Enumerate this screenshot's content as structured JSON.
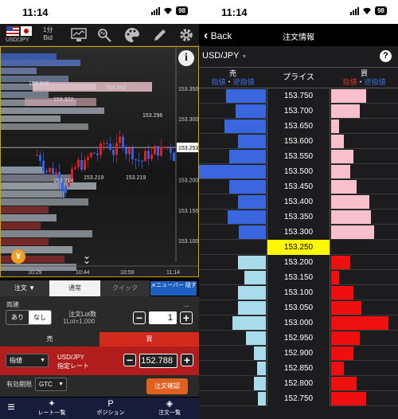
{
  "status": {
    "time": "11:14",
    "battery": "98"
  },
  "chart_screen": {
    "pair": "USD/JPY",
    "timeframe_num": "1分",
    "timeframe_label": "Bid",
    "price_labels": [
      "153.350",
      "153.300",
      "153.253",
      "153.200",
      "153.150",
      "153.100"
    ],
    "time_labels": [
      "10:29",
      "10:44",
      "10:59",
      "11:14"
    ],
    "annotations": [
      "153.349",
      "153.342",
      "153.322",
      "153.296",
      "153.214",
      "153.219",
      "153.219"
    ],
    "current_price": "153.253",
    "info_icon": "i",
    "yen_icon": "¥"
  },
  "order_panel": {
    "tabs": [
      "注文 ▼",
      "通常",
      "クイック",
      "メニューバー 隠す"
    ],
    "both_label": "両建",
    "both_options": [
      "あり",
      "なし"
    ],
    "lot_label": "注文Lot数",
    "lot_sub": "1Lot=1,000",
    "lot_value": "1",
    "more_icon": "...",
    "sell": "売",
    "buy": "買",
    "order_type": "指値",
    "rate_label_1": "USD/JPY",
    "rate_label_2": "指定レート",
    "rate_value": "152.788",
    "expiry_label": "有効期限",
    "expiry_value": "GTC",
    "confirm": "注文確認",
    "minus": "−",
    "plus": "+"
  },
  "bottom_nav": [
    {
      "icon": "✦",
      "label": "レート一覧"
    },
    {
      "icon": "P",
      "label": "ポジション"
    },
    {
      "icon": "◈",
      "label": "注文一覧"
    }
  ],
  "menu_icon": "≡",
  "right": {
    "back": "Back",
    "title": "注文情報",
    "pair": "USD/JPY",
    "pair_caret": "▼",
    "help": "?",
    "headers": {
      "sell": "売",
      "price": "プライス",
      "buy": "買"
    },
    "sell_sub": [
      "指値",
      "・",
      "逆指値"
    ],
    "buy_sub": [
      "指値",
      "・",
      "逆指値"
    ],
    "rows": [
      {
        "price": "153.750",
        "sell": 0.6,
        "buy": 0.55
      },
      {
        "price": "153.700",
        "sell": 0.45,
        "buy": 0.45
      },
      {
        "price": "153.650",
        "sell": 0.62,
        "buy": 0.12
      },
      {
        "price": "153.600",
        "sell": 0.42,
        "buy": 0.2
      },
      {
        "price": "153.550",
        "sell": 0.55,
        "buy": 0.35
      },
      {
        "price": "153.500",
        "sell": 1.0,
        "buy": 0.3
      },
      {
        "price": "153.450",
        "sell": 0.55,
        "buy": 0.4
      },
      {
        "price": "153.400",
        "sell": 0.42,
        "buy": 0.6
      },
      {
        "price": "153.350",
        "sell": 0.57,
        "buy": 0.62
      },
      {
        "price": "153.300",
        "sell": 0.4,
        "buy": 0.68
      },
      {
        "price": "153.250",
        "sell": 0,
        "buy": 0,
        "mid": true
      },
      {
        "price": "153.200",
        "sell": 0.42,
        "buy": 0.3
      },
      {
        "price": "153.150",
        "sell": 0.32,
        "buy": 0.12
      },
      {
        "price": "153.100",
        "sell": 0.42,
        "buy": 0.35
      },
      {
        "price": "153.050",
        "sell": 0.42,
        "buy": 0.48
      },
      {
        "price": "153.000",
        "sell": 0.5,
        "buy": 0.9
      },
      {
        "price": "152.950",
        "sell": 0.3,
        "buy": 0.45
      },
      {
        "price": "152.900",
        "sell": 0.18,
        "buy": 0.35
      },
      {
        "price": "152.850",
        "sell": 0.13,
        "buy": 0.2
      },
      {
        "price": "152.800",
        "sell": 0.18,
        "buy": 0.4
      },
      {
        "price": "152.750",
        "sell": 0.12,
        "buy": 0.55
      }
    ]
  },
  "colors": {
    "sell_blue": "#3a66e0",
    "sell_light": "#a8dcec",
    "buy_pink": "#f8c0cc",
    "buy_red": "#ee1010",
    "accent_orange": "#e06020"
  }
}
